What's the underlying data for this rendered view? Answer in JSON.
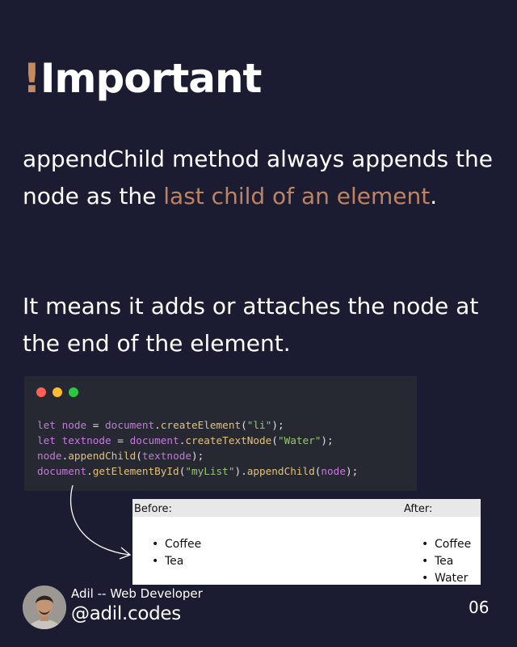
{
  "title": {
    "accent": "!",
    "text": "Important"
  },
  "paragraph1": {
    "part1": "appendChild method always appends the node as the ",
    "accent": "last child of an element",
    "part2": "."
  },
  "paragraph2": {
    "text": "It means it adds or attaches the node at the end of the element."
  },
  "code": {
    "lines": [
      "let node = document.createElement(\"li\");",
      "let textnode = document.createTextNode(\"Water\");",
      "node.appendChild(textnode);",
      "document.getElementById(\"myList\").appendChild(node);"
    ]
  },
  "demo": {
    "before_label": "Before:",
    "after_label": "After:",
    "before_items": [
      "Coffee",
      "Tea"
    ],
    "after_items": [
      "Coffee",
      "Tea",
      "Water"
    ]
  },
  "author": {
    "name": "Adil -- Web Developer",
    "handle": "@adil.codes"
  },
  "page_number": "06",
  "colors": {
    "background": "#1b1c31",
    "accent": "#c08361",
    "code_bg": "#262932"
  }
}
